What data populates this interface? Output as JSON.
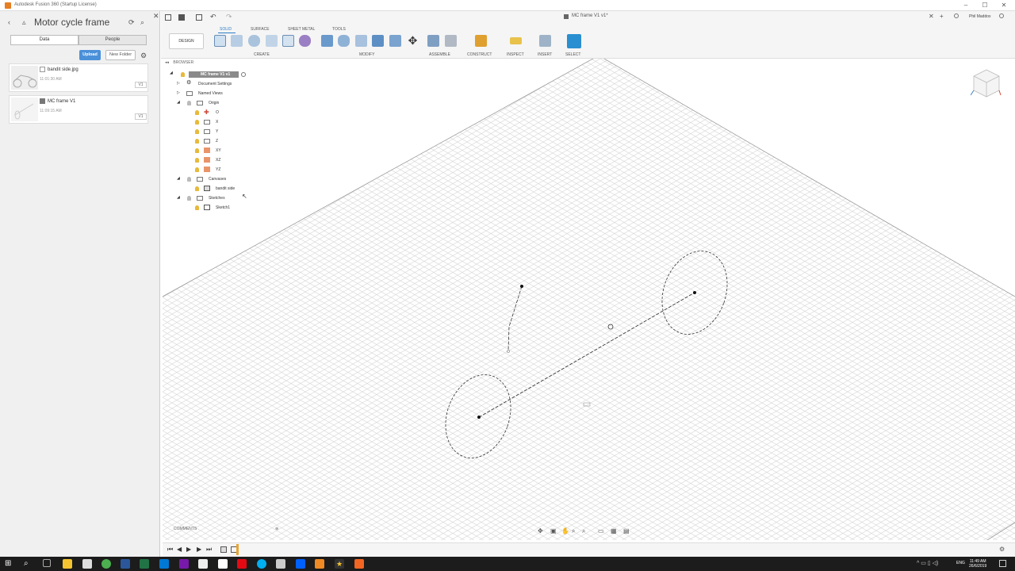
{
  "window": {
    "title": "Autodesk Fusion 360 (Startup License)"
  },
  "data_panel": {
    "title": "Motor cycle frame",
    "tabs": [
      "Data",
      "People"
    ],
    "upload_label": "Upload",
    "new_folder_label": "New Folder",
    "files": [
      {
        "name": "bandit side.jpg",
        "time": "11:01:30 AM",
        "version": "V1"
      },
      {
        "name": "MC frame V1",
        "time": "11:09:15 AM",
        "version": "V1"
      }
    ]
  },
  "document": {
    "tab_title": "MC frame V1 v1*",
    "user": "Phil Maddox"
  },
  "toolbar": {
    "tabs": [
      "SOLID",
      "SURFACE",
      "SHEET METAL",
      "TOOLS"
    ],
    "workspace": "DESIGN",
    "groups": [
      "CREATE",
      "MODIFY",
      "ASSEMBLE",
      "CONSTRUCT",
      "INSPECT",
      "INSERT",
      "SELECT"
    ]
  },
  "browser": {
    "header": "BROWSER",
    "root": "MC frame V1 v1",
    "items": {
      "document_settings": "Document Settings",
      "named_views": "Named Views",
      "origin": "Origin",
      "origin_children": [
        "O",
        "X",
        "Y",
        "Z",
        "XY",
        "XZ",
        "YZ"
      ],
      "canvases": "Canvases",
      "canvas_child": "bandit side",
      "sketches": "Sketches",
      "sketch_child": "Sketch1"
    }
  },
  "comments": {
    "label": "COMMENTS"
  },
  "taskbar": {
    "language": "ENG",
    "time": "11:49 AM",
    "date": "26/6/2019"
  },
  "colors": {
    "accent": "#2a7cc7",
    "upload": "#4a90d9",
    "bulb": "#e8b93b",
    "grid": "#d8d8d8",
    "taskbar": "#1c1c1c"
  }
}
